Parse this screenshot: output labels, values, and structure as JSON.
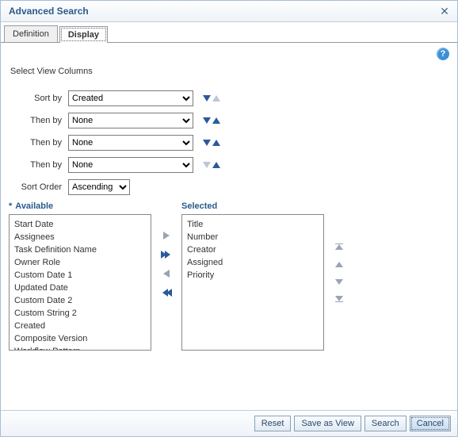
{
  "title": "Advanced Search",
  "tabs": {
    "definition": "Definition",
    "display": "Display"
  },
  "help_char": "?",
  "section_title": "Select View Columns",
  "labels": {
    "sort_by": "Sort by",
    "then_by": "Then by",
    "sort_order": "Sort Order",
    "available": "Available",
    "selected": "Selected"
  },
  "sort_rows": [
    {
      "value": "Created",
      "down_active": true,
      "up_active": false
    },
    {
      "value": "None",
      "down_active": true,
      "up_active": true
    },
    {
      "value": "None",
      "down_active": true,
      "up_active": true
    },
    {
      "value": "None",
      "down_active": false,
      "up_active": true
    }
  ],
  "sort_order_value": "Ascending",
  "available_items": [
    "Start Date",
    "Assignees",
    "Task Definition Name",
    "Owner Role",
    "Custom Date 1",
    "Updated Date",
    "Custom Date 2",
    "Custom String 2",
    "Created",
    "Composite Version",
    "Workflow Pattern"
  ],
  "selected_items": [
    "Title",
    "Number",
    "Creator",
    "Assigned",
    "Priority"
  ],
  "buttons": {
    "reset": "Reset",
    "save_as_view": "Save as View",
    "search": "Search",
    "cancel": "Cancel"
  }
}
